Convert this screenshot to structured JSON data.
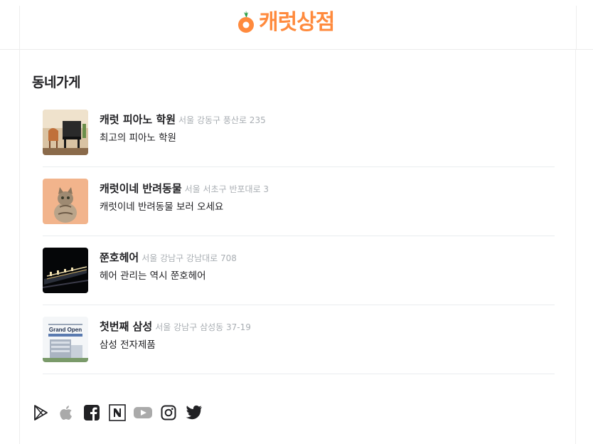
{
  "header": {
    "logo_text": "캐럿상점",
    "brand_color": "#ff8a3d"
  },
  "section": {
    "title": "동네가게"
  },
  "stores": [
    {
      "name": "캐럿 피아노 학원",
      "address": "서울 강동구 풍산로 235",
      "description": "최고의 피아노 학원",
      "thumbnail": "piano-room-photo"
    },
    {
      "name": "캐럿이네 반려동물",
      "address": "서울 서초구 반포대로 3",
      "description": "캐럿이네 반려동물 보러 오세요",
      "thumbnail": "cat-photo"
    },
    {
      "name": "쭌호헤어",
      "address": "서울 강남구 강남대로 708",
      "description": "헤어 관리는 역시 쭌호헤어",
      "thumbnail": "night-building-photo"
    },
    {
      "name": "첫번째 삼성",
      "address": "서울 강남구 삼성동 37-19",
      "description": "삼성 전자제품",
      "thumbnail": "grand-open-poster"
    }
  ],
  "thumbnail_poster": {
    "headline": "Grand Open"
  },
  "footer": {
    "social_icons": [
      "google-play-icon",
      "apple-icon",
      "facebook-icon",
      "naver-blog-icon",
      "youtube-icon",
      "instagram-icon",
      "twitter-icon"
    ]
  }
}
